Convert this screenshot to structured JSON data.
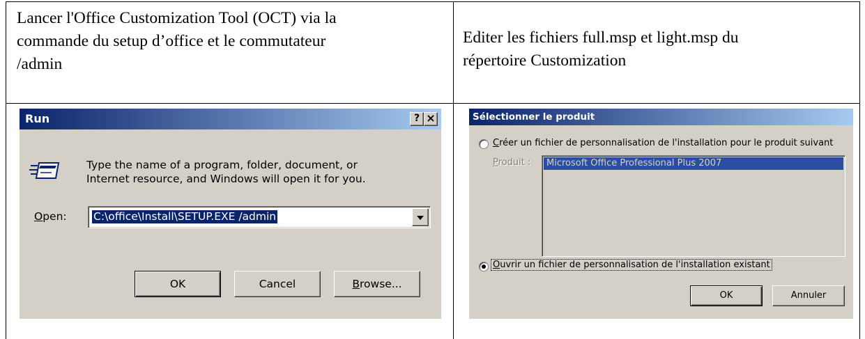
{
  "cells": {
    "top_left_lines": [
      "Lancer l'Office Customization Tool (OCT) via la",
      "commande du setup d’office et le commutateur",
      "/admin"
    ],
    "top_right_lines": [
      "Editer les fichiers full.msp et light.msp du",
      "répertoire Customization"
    ]
  },
  "run_dialog": {
    "title": "Run",
    "help_button": "?",
    "close_button": "×",
    "message_line1": "Type the name of a program, folder, document, or",
    "message_line2": "Internet resource, and Windows will open it for you.",
    "open_label_u": "O",
    "open_label_rest": "pen:",
    "open_value": "C:\\office\\Install\\SETUP.EXE /admin",
    "ok_button": "OK",
    "cancel_button": "Cancel",
    "browse_button_u": "B",
    "browse_button_rest": "rowse...",
    "icon": "run-icon"
  },
  "product_dialog": {
    "title": "Sélectionner le produit",
    "option_create_u": "C",
    "option_create_rest": "réer un fichier de personnalisation de l'installation pour le produit suivant",
    "product_label_u": "P",
    "product_label_rest": "roduit :",
    "product_selected": "Microsoft Office Professional Plus 2007",
    "option_open_u": "O",
    "option_open_rest": "uvrir un fichier de personnalisation de l'installation existant",
    "selected_option": "open-existing",
    "ok_button": "OK",
    "cancel_button": "Annuler"
  },
  "colors": {
    "titlebar_start": "#0a246a",
    "titlebar_end": "#a6caf0",
    "dialog_face": "#d4d0c8",
    "selection": "#0a246a",
    "disabled_selection": "#2a4fa0"
  }
}
